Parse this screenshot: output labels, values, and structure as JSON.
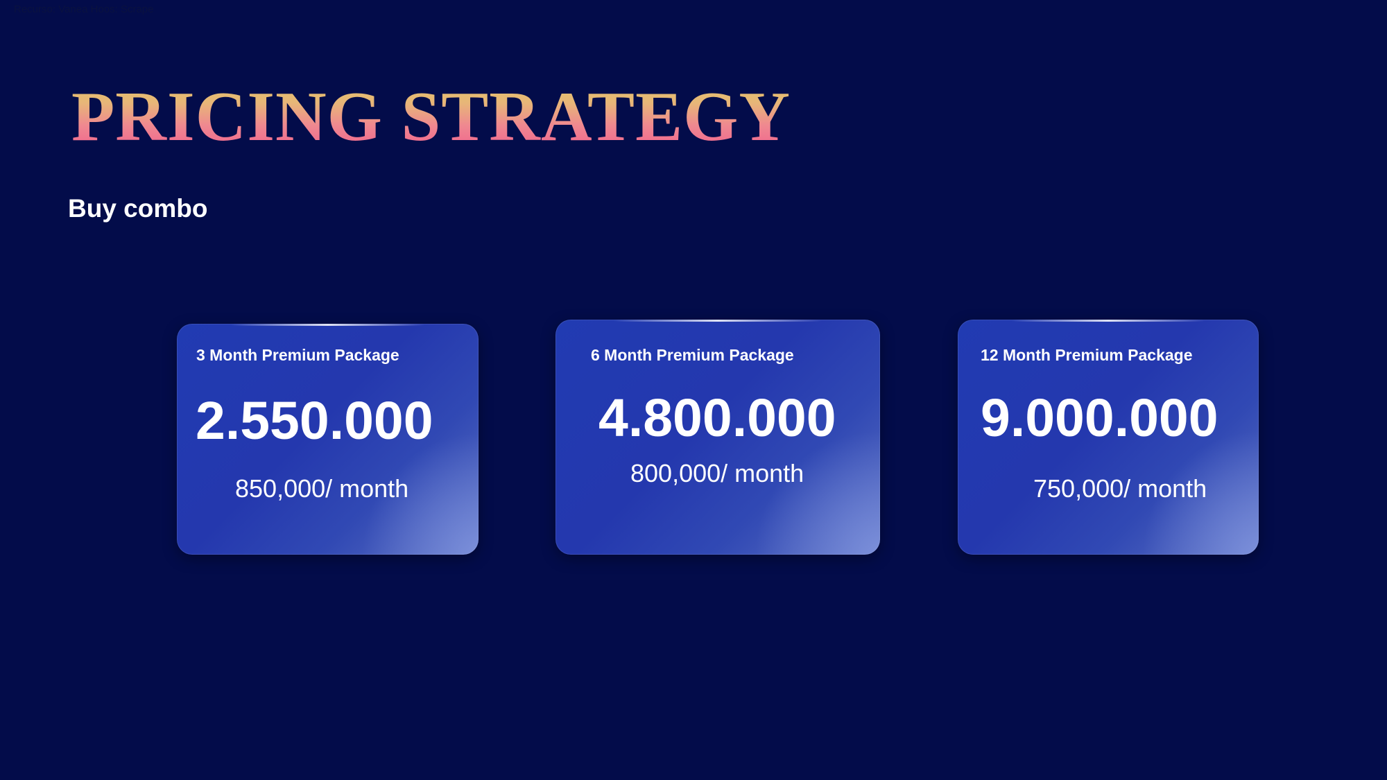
{
  "slide": {
    "top_note": "Recurso: Vanea Hoos: Scrape",
    "title": "PRICING STRATEGY",
    "subtitle": "Buy combo",
    "packages": [
      {
        "label": "3 Month Premium Package",
        "price": "2.550.000",
        "monthly": "850,000/ month"
      },
      {
        "label": "6 Month Premium Package",
        "price": "4.800.000",
        "monthly": "800,000/ month"
      },
      {
        "label": "12 Month Premium Package",
        "price": "9.000.000",
        "monthly": "750,000/ month"
      }
    ]
  },
  "colors": {
    "background": "#030c4a",
    "card_blue": "#2438ae",
    "title_gold": "#e4c36a",
    "title_pink": "#f0608e"
  }
}
